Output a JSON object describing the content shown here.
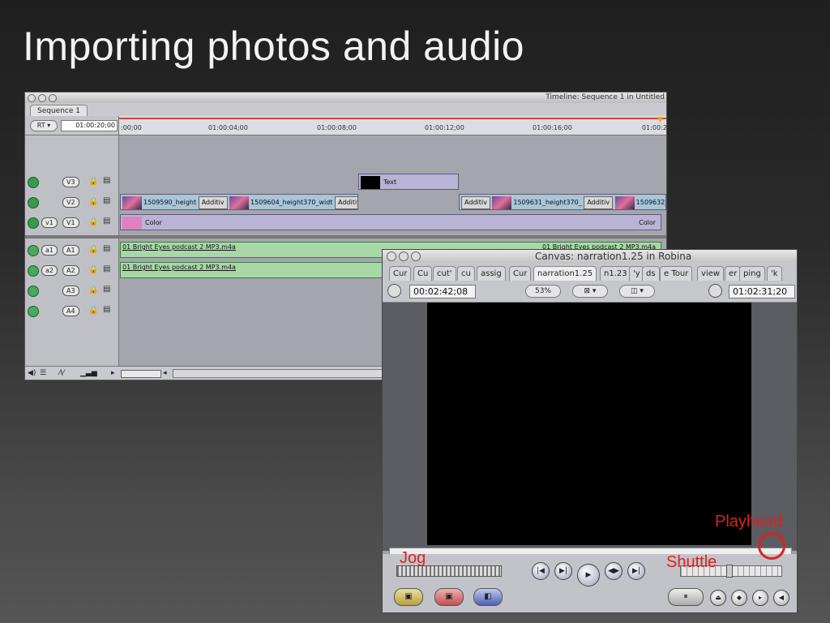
{
  "slide": {
    "title": "Importing photos and audio"
  },
  "timeline": {
    "window_title": "Timeline: Sequence 1 in Untitled",
    "tab": "Sequence 1",
    "rt_label": "RT ▾",
    "timecode": "01:00:20;00",
    "ruler_ticks": [
      ":00;00",
      "01:00:04;00",
      "01:00:08;00",
      "01:00:12;00",
      "01:00:16;00",
      "01:00:2"
    ],
    "video_tracks": [
      {
        "name": "V3",
        "src": ""
      },
      {
        "name": "V2",
        "src": ""
      },
      {
        "name": "V1",
        "src": "v1"
      }
    ],
    "audio_tracks": [
      {
        "name": "A1",
        "src": "a1"
      },
      {
        "name": "A2",
        "src": "a2"
      },
      {
        "name": "A3",
        "src": ""
      },
      {
        "name": "A4",
        "src": ""
      }
    ],
    "clips": {
      "v3_text": "Text",
      "v2_clip1": "1509590_height",
      "v2_trans1": "Additiv",
      "v2_clip2": "1509604_height370_widt",
      "v2_trans2": "Additiv",
      "v2_trans3": "Additiv",
      "v2_clip3": "1509631_height370_",
      "v2_trans4": "Additiv",
      "v2_clip4": "1509632_",
      "v1_color_left": "Color",
      "v1_color_right": "Color",
      "a1_clip_left": "01 Bright Eyes podcast 2 MP3.m4a",
      "a1_clip_right": "01 Bright Eyes podcast 2 MP3.m4a",
      "a2_clip_left": "01 Bright Eyes podcast 2 MP3.m4a"
    }
  },
  "canvas": {
    "window_title": "Canvas: narration1.25 in Robina",
    "tabs": [
      "Cur",
      "Cu",
      "cut'",
      "cu",
      "assig",
      "Cur",
      "narration1.25",
      "n1.23",
      "'y",
      "ds",
      "e Tour",
      "view",
      "er",
      "ping",
      "'k"
    ],
    "active_tab_index": 6,
    "timecode_left": "00:02:42;08",
    "zoom": "53%",
    "timecode_right": "01:02:31;20",
    "annotations": {
      "jog": "Jog",
      "shuttle": "Shuttle",
      "playhead": "Playhead"
    }
  },
  "colors": {
    "accent_red": "#e02020",
    "clip_video": "#a9c6d8",
    "clip_audio": "#a8d8a8",
    "clip_color": "#b9b3d6"
  }
}
